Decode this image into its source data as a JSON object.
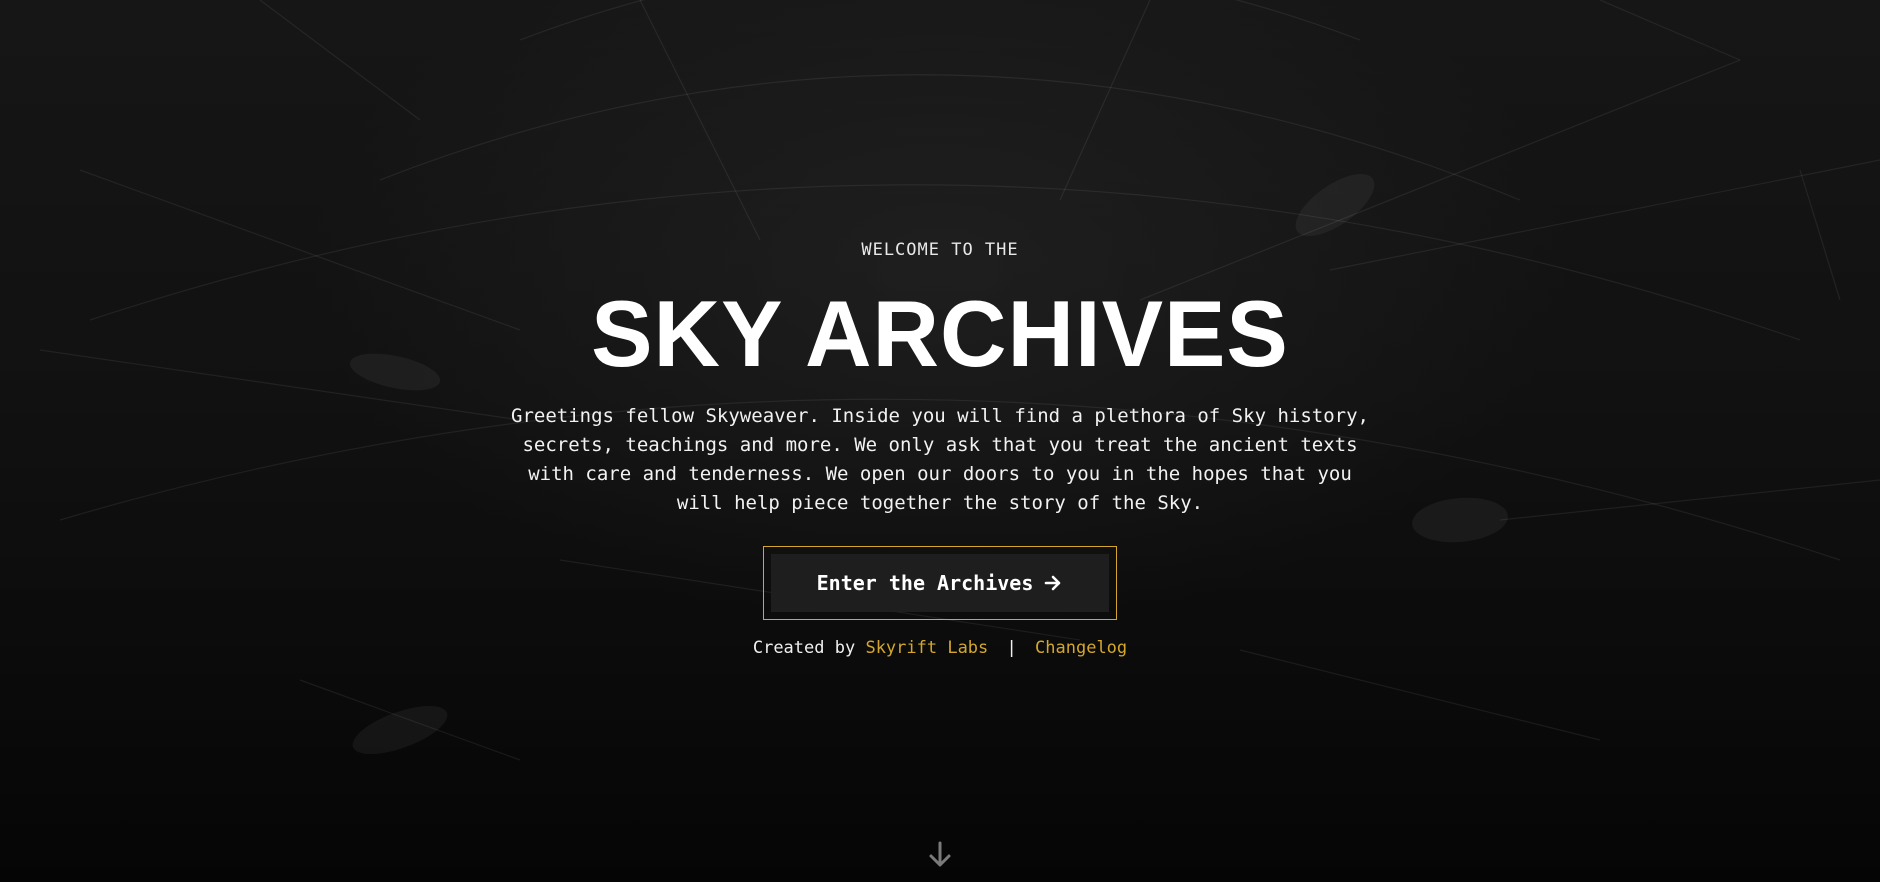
{
  "hero": {
    "eyebrow": "WELCOME TO THE",
    "title": "SKY ARCHIVES",
    "description": "Greetings fellow Skyweaver. Inside you will find a plethora of Sky history, secrets, teachings and more. We only ask that you treat the ancient texts with care and tenderness. We open our doors to you in the hopes that you will help piece together the story of the Sky.",
    "cta_label": "Enter the Archives",
    "cta_icon": "arrow-right-icon"
  },
  "credits": {
    "prefix": "Created by",
    "author_link": "Skyrift Labs",
    "separator": "|",
    "changelog_link": "Changelog"
  },
  "scroll": {
    "icon": "arrow-down-icon"
  },
  "colors": {
    "accent": "#d4a72c",
    "background": "#0c0c0c",
    "text": "#ffffff",
    "button_bg": "#1e1e1e"
  }
}
